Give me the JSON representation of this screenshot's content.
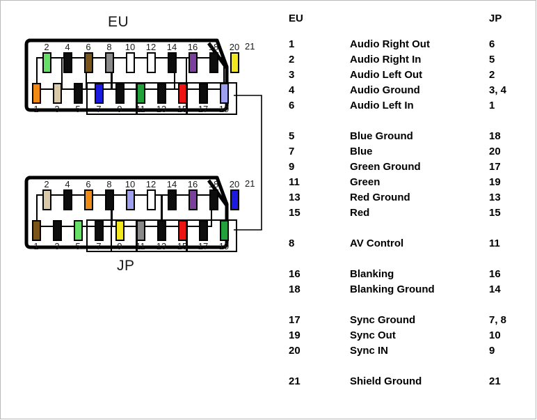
{
  "diagram": {
    "eu": {
      "title": "EU",
      "shield_label": "21",
      "top_pins": [
        {
          "num": "2",
          "color": "#66e066"
        },
        {
          "num": "4",
          "color": "#0d0d0d"
        },
        {
          "num": "6",
          "color": "#7a5418"
        },
        {
          "num": "8",
          "color": "#8a8a8a"
        },
        {
          "num": "10",
          "color": "#ffffff"
        },
        {
          "num": "12",
          "color": "#ffffff"
        },
        {
          "num": "14",
          "color": "#0d0d0d"
        },
        {
          "num": "16",
          "color": "#7b3f9d"
        },
        {
          "num": "18",
          "color": "#0d0d0d"
        },
        {
          "num": "20",
          "color": "#f2e820"
        }
      ],
      "bottom_pins": [
        {
          "num": "1",
          "color": "#f08a16"
        },
        {
          "num": "3",
          "color": "#d8c9a8"
        },
        {
          "num": "5",
          "color": "#0d0d0d"
        },
        {
          "num": "7",
          "color": "#1a1ae0"
        },
        {
          "num": "9",
          "color": "#0d0d0d"
        },
        {
          "num": "11",
          "color": "#22a03a"
        },
        {
          "num": "13",
          "color": "#0d0d0d"
        },
        {
          "num": "15",
          "color": "#ef1414"
        },
        {
          "num": "17",
          "color": "#0d0d0d"
        },
        {
          "num": "19",
          "color": "#9f9ff0"
        }
      ]
    },
    "jp": {
      "title": "JP",
      "shield_label": "21",
      "top_pins": [
        {
          "num": "2",
          "color": "#d8c9a8"
        },
        {
          "num": "4",
          "color": "#0d0d0d"
        },
        {
          "num": "6",
          "color": "#f08a16"
        },
        {
          "num": "8",
          "color": "#0d0d0d"
        },
        {
          "num": "10",
          "color": "#9f9ff0"
        },
        {
          "num": "12",
          "color": "#ffffff"
        },
        {
          "num": "14",
          "color": "#0d0d0d"
        },
        {
          "num": "16",
          "color": "#7b3f9d"
        },
        {
          "num": "18",
          "color": "#0d0d0d"
        },
        {
          "num": "20",
          "color": "#1a1ae0"
        }
      ],
      "bottom_pins": [
        {
          "num": "1",
          "color": "#7a5418"
        },
        {
          "num": "3",
          "color": "#0d0d0d"
        },
        {
          "num": "5",
          "color": "#66e066"
        },
        {
          "num": "7",
          "color": "#0d0d0d"
        },
        {
          "num": "9",
          "color": "#f2e820"
        },
        {
          "num": "11",
          "color": "#8a8a8a"
        },
        {
          "num": "13",
          "color": "#0d0d0d"
        },
        {
          "num": "15",
          "color": "#ef1414"
        },
        {
          "num": "17",
          "color": "#0d0d0d"
        },
        {
          "num": "19",
          "color": "#22a03a"
        }
      ]
    }
  },
  "table": {
    "headers": {
      "eu": "EU",
      "signal": "",
      "jp": "JP"
    },
    "groups": [
      {
        "rows": [
          {
            "eu": "1",
            "signal": "Audio Right Out",
            "jp": "6"
          },
          {
            "eu": "2",
            "signal": "Audio Right In",
            "jp": "5"
          },
          {
            "eu": "3",
            "signal": "Audio Left Out",
            "jp": "2"
          },
          {
            "eu": "4",
            "signal": "Audio Ground",
            "jp": "3, 4"
          },
          {
            "eu": "6",
            "signal": "Audio Left In",
            "jp": "1"
          }
        ]
      },
      {
        "rows": [
          {
            "eu": "5",
            "signal": "Blue Ground",
            "jp": "18"
          },
          {
            "eu": "7",
            "signal": "Blue",
            "jp": "20"
          },
          {
            "eu": "9",
            "signal": "Green Ground",
            "jp": "17"
          },
          {
            "eu": "11",
            "signal": "Green",
            "jp": "19"
          },
          {
            "eu": "13",
            "signal": "Red Ground",
            "jp": "13"
          },
          {
            "eu": "15",
            "signal": "Red",
            "jp": "15"
          }
        ]
      },
      {
        "rows": [
          {
            "eu": "8",
            "signal": "AV Control",
            "jp": "11"
          }
        ]
      },
      {
        "rows": [
          {
            "eu": "16",
            "signal": "Blanking",
            "jp": "16"
          },
          {
            "eu": "18",
            "signal": "Blanking Ground",
            "jp": "14"
          }
        ]
      },
      {
        "rows": [
          {
            "eu": "17",
            "signal": "Sync Ground",
            "jp": "7, 8"
          },
          {
            "eu": "19",
            "signal": "Sync Out",
            "jp": "10"
          },
          {
            "eu": "20",
            "signal": "Sync IN",
            "jp": "9"
          }
        ]
      },
      {
        "rows": [
          {
            "eu": "21",
            "signal": "Shield Ground",
            "jp": "21"
          }
        ]
      }
    ]
  }
}
